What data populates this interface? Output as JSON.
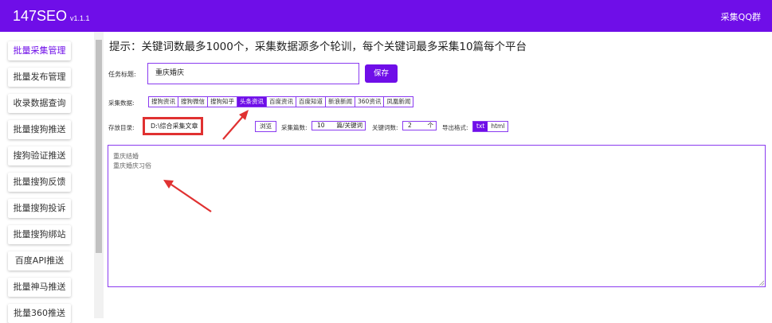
{
  "header": {
    "app_name": "147SEO",
    "version": "v1.1.1",
    "qq_group_label": "采集QQ群",
    "color": "#6f0ee8"
  },
  "sidebar": {
    "items": [
      {
        "label": "批量采集管理",
        "active": true
      },
      {
        "label": "批量发布管理"
      },
      {
        "label": "收录数据查询"
      },
      {
        "label": "批量搜狗推送"
      },
      {
        "label": "搜狗验证推送"
      },
      {
        "label": "批量搜狗反馈"
      },
      {
        "label": "批量搜狗投诉"
      },
      {
        "label": "批量搜狗绑站"
      },
      {
        "label": "百度API推送"
      },
      {
        "label": "批量神马推送"
      },
      {
        "label": "批量360推送"
      }
    ]
  },
  "main": {
    "tip": "提示：关键词数最多1000个，采集数据源多个轮训，每个关键词最多采集10篇每个平台",
    "task_title": {
      "label": "任务标题:",
      "value": "重庆婚庆"
    },
    "save_label": "保存",
    "sources": {
      "label": "采集数据:",
      "items": [
        "搜狗资讯",
        "搜狗微信",
        "搜狗知乎",
        "头条资讯",
        "百度资讯",
        "百度知道",
        "新浪新闻",
        "360资讯",
        "凤凰新闻"
      ],
      "selected": "头条资讯"
    },
    "save_dir": {
      "label": "存放目录:",
      "value": "D:\\综合采集文章"
    },
    "browse_label": "浏览",
    "count": {
      "label": "采集篇数:",
      "value": "10",
      "unit": "篇/关键词"
    },
    "keyword_count": {
      "label": "关键词数:",
      "value": "2",
      "unit": "个"
    },
    "export": {
      "label": "导出格式:",
      "options": [
        "txt",
        "html"
      ],
      "selected": "txt"
    },
    "keywords": [
      "重庆结婚",
      "重庆婚庆习俗"
    ]
  }
}
